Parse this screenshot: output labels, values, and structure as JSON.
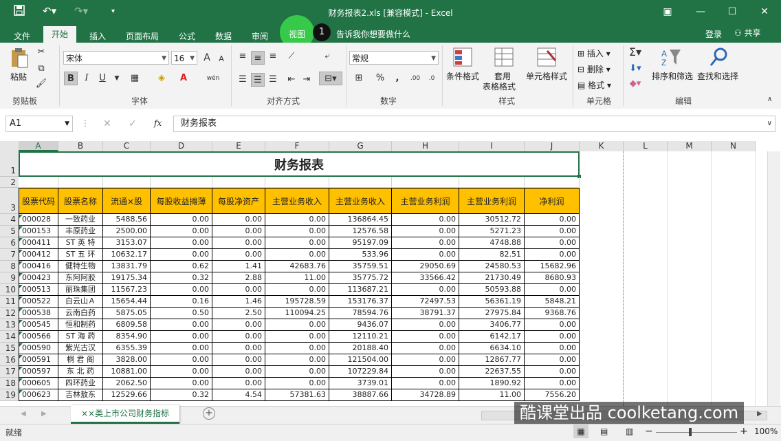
{
  "window": {
    "title": "财务报表2.xls  [兼容模式] - Excel",
    "quick_access": [
      "save-icon",
      "undo-icon",
      "redo-icon",
      "customize-icon"
    ]
  },
  "menu": {
    "tabs": [
      "文件",
      "开始",
      "插入",
      "页面布局",
      "公式",
      "数据",
      "审阅",
      "视图"
    ],
    "active_tab": "开始",
    "step_badge": "1",
    "tell_me": "告诉我你想要做什么",
    "login": "登录",
    "share": "共享"
  },
  "ribbon": {
    "clipboard": {
      "paste": "粘贴",
      "label": "剪贴板"
    },
    "font": {
      "name": "宋体",
      "size": "16",
      "bold": "B",
      "italic": "I",
      "underline": "U",
      "label": "字体",
      "grow": "A",
      "shrink": "A",
      "phonetic": "wén"
    },
    "alignment": {
      "label": "对齐方式"
    },
    "number": {
      "format": "常规",
      "label": "数字",
      "percent": "%",
      "comma": ","
    },
    "styles": {
      "conditional": "条件格式",
      "table": "套用",
      "table2": "表格格式",
      "cell": "单元格样式",
      "label": "样式"
    },
    "cells": {
      "insert": "插入",
      "delete": "删除",
      "format": "格式",
      "label": "单元格"
    },
    "editing": {
      "sort": "排序和筛选",
      "find": "查找和选择",
      "label": "编辑"
    }
  },
  "formula_bar": {
    "name_box": "A1",
    "fx": "fx",
    "value": "财务报表"
  },
  "grid": {
    "columns": [
      "A",
      "B",
      "C",
      "D",
      "E",
      "F",
      "G",
      "H",
      "I",
      "J",
      "K",
      "L",
      "M",
      "N"
    ],
    "rows": [
      "1",
      "2",
      "3",
      "4",
      "5",
      "6",
      "7",
      "8",
      "9",
      "10",
      "11",
      "12",
      "13",
      "14",
      "15",
      "16",
      "17",
      "18",
      "19"
    ],
    "title": "财务报表",
    "headers": [
      "股票代码",
      "股票名称",
      "流通×股",
      "每股收益摊薄",
      "每股净资产",
      "主营业务收入",
      "主营业务收入",
      "主营业务利润",
      "主营业务利润",
      "净利润"
    ],
    "data": [
      [
        "000028",
        "一致药业",
        "5488.56",
        "0.00",
        "0.00",
        "0.00",
        "136864.45",
        "0.00",
        "30512.72",
        "0.00"
      ],
      [
        "000153",
        "丰原药业",
        "2500.00",
        "0.00",
        "0.00",
        "0.00",
        "12576.58",
        "0.00",
        "5271.23",
        "0.00"
      ],
      [
        "000411",
        "ST 英 特",
        "3153.07",
        "0.00",
        "0.00",
        "0.00",
        "95197.09",
        "0.00",
        "4748.88",
        "0.00"
      ],
      [
        "000412",
        "ST 五 环",
        "10632.17",
        "0.00",
        "0.00",
        "0.00",
        "533.96",
        "0.00",
        "82.51",
        "0.00"
      ],
      [
        "000416",
        "健特生物",
        "13831.79",
        "0.62",
        "1.41",
        "42683.76",
        "35759.51",
        "29050.69",
        "24580.53",
        "15682.96"
      ],
      [
        "000423",
        "东阿阿胶",
        "19175.34",
        "0.32",
        "2.88",
        "11.00",
        "35775.72",
        "33566.42",
        "21730.49",
        "8680.93"
      ],
      [
        "000513",
        "丽珠集团",
        "11567.23",
        "0.00",
        "0.00",
        "0.00",
        "113687.21",
        "0.00",
        "50593.88",
        "0.00"
      ],
      [
        "000522",
        "白云山Ａ",
        "15654.44",
        "0.16",
        "1.46",
        "195728.59",
        "153176.37",
        "72497.53",
        "56361.19",
        "5848.21"
      ],
      [
        "000538",
        "云南白药",
        "5875.05",
        "0.50",
        "2.50",
        "110094.25",
        "78594.76",
        "38791.37",
        "27975.84",
        "9368.76"
      ],
      [
        "000545",
        "恒和制药",
        "6809.58",
        "0.00",
        "0.00",
        "0.00",
        "9436.07",
        "0.00",
        "3406.77",
        "0.00"
      ],
      [
        "000566",
        "ST 海 药",
        "8354.90",
        "0.00",
        "0.00",
        "0.00",
        "12110.21",
        "0.00",
        "6142.17",
        "0.00"
      ],
      [
        "000590",
        "紫光古汉",
        "6355.39",
        "0.00",
        "0.00",
        "0.00",
        "20188.40",
        "0.00",
        "6634.10",
        "0.00"
      ],
      [
        "000591",
        "桐 君 阁",
        "3828.00",
        "0.00",
        "0.00",
        "0.00",
        "121504.00",
        "0.00",
        "12867.77",
        "0.00"
      ],
      [
        "000597",
        "东 北 药",
        "10881.00",
        "0.00",
        "0.00",
        "0.00",
        "107229.84",
        "0.00",
        "22637.55",
        "0.00"
      ],
      [
        "000605",
        "四环药业",
        "2062.50",
        "0.00",
        "0.00",
        "0.00",
        "3739.01",
        "0.00",
        "1890.92",
        "0.00"
      ],
      [
        "000623",
        "吉林敖东",
        "12529.66",
        "0.32",
        "4.54",
        "57381.63",
        "38887.66",
        "34728.89",
        "11.00",
        "7556.20"
      ]
    ]
  },
  "sheet": {
    "tab": "××类上市公司财务指标",
    "add": "+"
  },
  "status": {
    "ready": "就绪",
    "zoom": "100%"
  },
  "watermark": "酷课堂出品 coolketang.com"
}
